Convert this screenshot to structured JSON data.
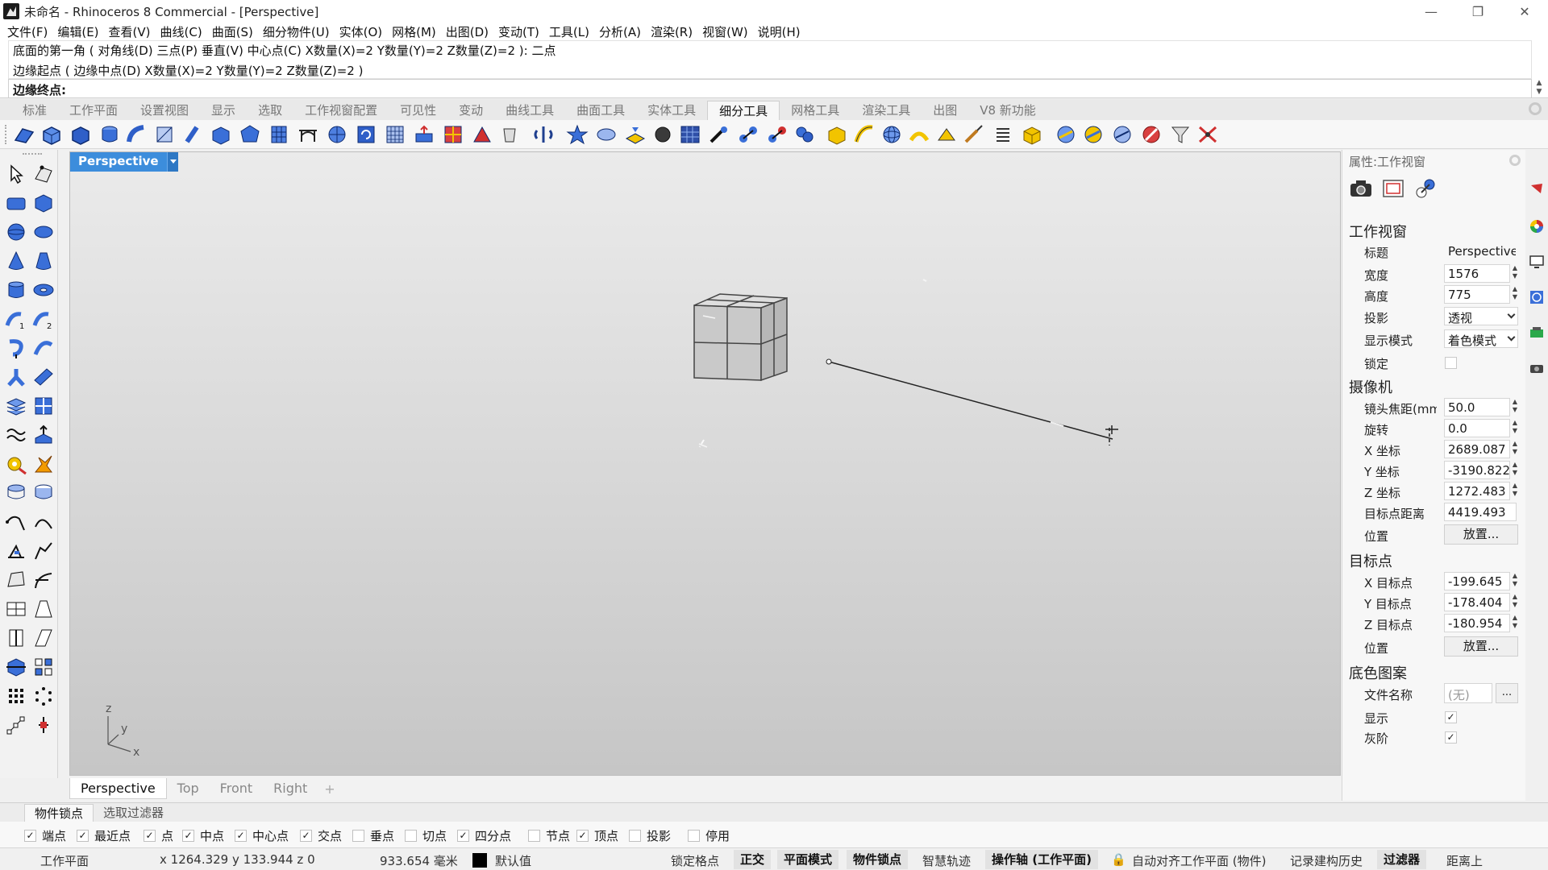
{
  "window": {
    "title": "未命名 - Rhinoceros 8 Commercial - [Perspective]",
    "minimize_glyph": "—",
    "restore_glyph": "❐",
    "close_glyph": "✕"
  },
  "menu": [
    "文件(F)",
    "编辑(E)",
    "查看(V)",
    "曲线(C)",
    "曲面(S)",
    "细分物件(U)",
    "实体(O)",
    "网格(M)",
    "出图(D)",
    "变动(T)",
    "工具(L)",
    "分析(A)",
    "渲染(R)",
    "视窗(W)",
    "说明(H)"
  ],
  "command": {
    "history_1": "底面的第一角 ( 对角线(D)  三点(P)  垂直(V)  中心点(C)  X数量(X)=2  Y数量(Y)=2  Z数量(Z)=2 ): 二点",
    "history_2": "边缘起点 ( 边缘中点(D)  X数量(X)=2  Y数量(Y)=2  Z数量(Z)=2 )",
    "prompt": "边缘终点:",
    "input_value": ""
  },
  "toolbar_tabs": [
    "标准",
    "工作平面",
    "设置视图",
    "显示",
    "选取",
    "工作视窗配置",
    "可见性",
    "变动",
    "曲线工具",
    "曲面工具",
    "实体工具",
    "细分工具",
    "网格工具",
    "渲染工具",
    "出图",
    "V8 新功能"
  ],
  "active_toolbar_tab": "细分工具",
  "viewport": {
    "title": "Perspective",
    "axis_z": "z",
    "axis_y": "y",
    "axis_x": "x"
  },
  "viewport_tabs": [
    "Perspective",
    "Top",
    "Front",
    "Right"
  ],
  "viewport_tab_add": "+",
  "properties": {
    "header": "属性:工作视窗",
    "section_viewport": "工作视窗",
    "title_label": "标题",
    "title_value": "Perspective",
    "width_label": "宽度",
    "width_value": "1576",
    "height_label": "高度",
    "height_value": "775",
    "projection_label": "投影",
    "projection_value": "透视",
    "display_mode_label": "显示模式",
    "display_mode_value": "着色模式",
    "lock_label": "锁定",
    "section_camera": "摄像机",
    "lens_label": "镜头焦距(mm)",
    "lens_value": "50.0",
    "rotation_label": "旋转",
    "rotation_value": "0.0",
    "cam_x_label": "X 坐标",
    "cam_x_value": "2689.087",
    "cam_y_label": "Y 坐标",
    "cam_y_value": "-3190.822",
    "cam_z_label": "Z 坐标",
    "cam_z_value": "1272.483",
    "target_dist_label": "目标点距离",
    "target_dist_value": "4419.493",
    "cam_pos_label": "位置",
    "place_button": "放置...",
    "section_target": "目标点",
    "tgt_x_label": "X 目标点",
    "tgt_x_value": "-199.645",
    "tgt_y_label": "Y 目标点",
    "tgt_y_value": "-178.404",
    "tgt_z_label": "Z 目标点",
    "tgt_z_value": "-180.954",
    "tgt_pos_label": "位置",
    "section_wallpaper": "底色图案",
    "filename_label": "文件名称",
    "filename_value": "(无)",
    "browse_button": "...",
    "show_label": "显示",
    "gray_label": "灰阶",
    "check_glyph": "✓"
  },
  "osnap_tabs": [
    "物件锁点",
    "选取过滤器"
  ],
  "osnaps": [
    {
      "label": "端点",
      "checked": true
    },
    {
      "label": "最近点",
      "checked": true
    },
    {
      "label": "点",
      "checked": true
    },
    {
      "label": "中点",
      "checked": true
    },
    {
      "label": "中心点",
      "checked": true
    },
    {
      "label": "交点",
      "checked": true
    },
    {
      "label": "垂点",
      "checked": false
    },
    {
      "label": "切点",
      "checked": false
    },
    {
      "label": "四分点",
      "checked": true
    },
    {
      "label": "节点",
      "checked": false
    },
    {
      "label": "顶点",
      "checked": true
    },
    {
      "label": "投影",
      "checked": false
    },
    {
      "label": "停用",
      "checked": false
    }
  ],
  "status": {
    "cplane": "工作平面",
    "coords": "x 1264.329   y 133.944   z 0",
    "distance": "933.654 毫米",
    "layer": "默认值",
    "grid_snap": "锁定格点",
    "ortho": "正交",
    "planar": "平面模式",
    "osnap": "物件锁点",
    "smart_track": "智慧轨迹",
    "gumball": "操作轴 (工作平面)",
    "auto_align": "自动对齐工作平面 (物件)",
    "record_history": "记录建构历史",
    "filter": "过滤器",
    "distance_short": "距离上"
  }
}
